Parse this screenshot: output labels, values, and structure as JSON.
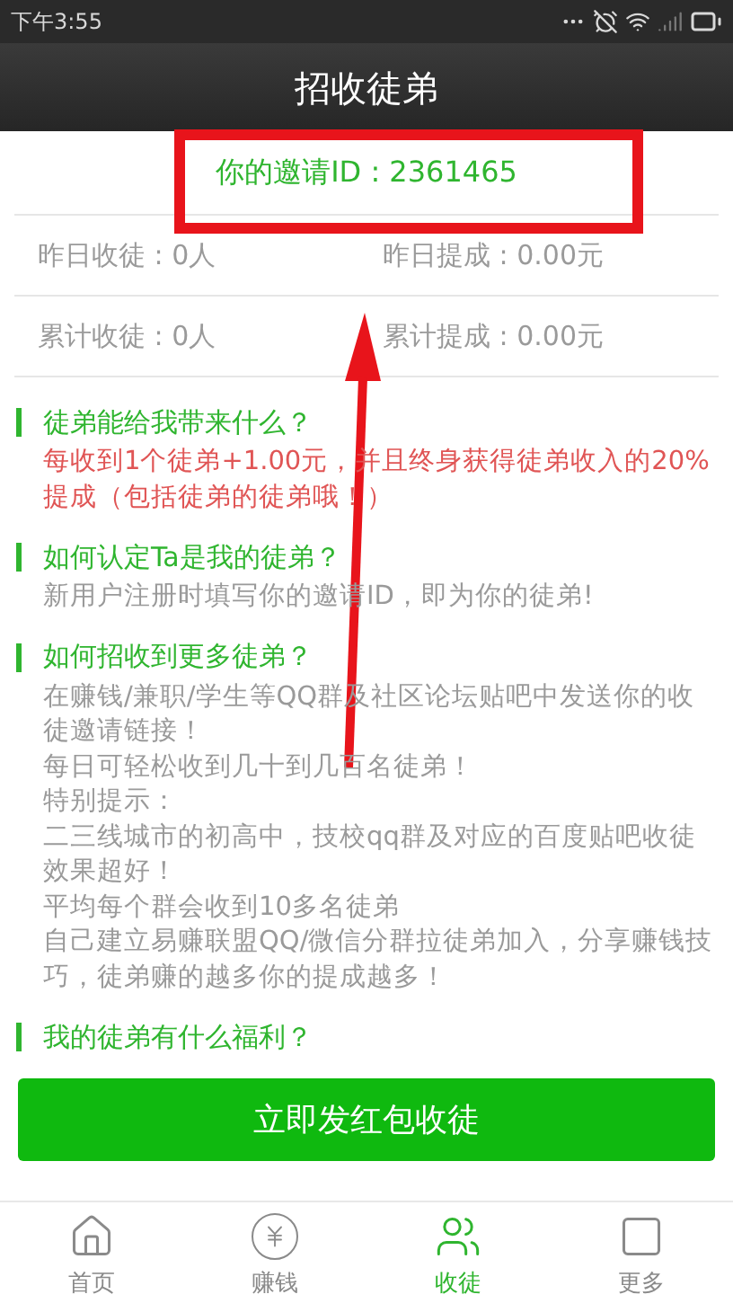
{
  "status_bar": {
    "time": "下午3:55"
  },
  "title": "招收徒弟",
  "invite": {
    "text": "你的邀请ID : 2361465"
  },
  "stats": [
    {
      "left": "昨日收徒 : 0人",
      "right": "昨日提成 : 0.00元"
    },
    {
      "left": "累计收徒 : 0人",
      "right": "累计提成 : 0.00元"
    }
  ],
  "sections": [
    {
      "heading": "徒弟能给我带来什么？",
      "paragraphs": [
        {
          "kind": "highlight",
          "text": "每收到1个徒弟+1.00元，并且终身获得徒弟收入的20%提成（包括徒弟的徒弟哦！）"
        }
      ]
    },
    {
      "heading": "如何认定Ta是我的徒弟？",
      "paragraphs": [
        {
          "kind": "plain",
          "text": "新用户注册时填写你的邀请ID，即为你的徒弟!"
        }
      ]
    },
    {
      "heading": "如何招收到更多徒弟？",
      "paragraphs": [
        {
          "kind": "plain",
          "text": "在赚钱/兼职/学生等QQ群及社区论坛贴吧中发送你的收徒邀请链接！"
        },
        {
          "kind": "plain",
          "text": "每日可轻松收到几十到几百名徒弟！"
        },
        {
          "kind": "plain",
          "text": "特别提示："
        },
        {
          "kind": "plain",
          "text": "二三线城市的初高中，技校qq群及对应的百度贴吧收徒效果超好！"
        },
        {
          "kind": "plain",
          "text": "平均每个群会收到10多名徒弟"
        },
        {
          "kind": "plain",
          "text": "自己建立易赚联盟QQ/微信分群拉徒弟加入，分享赚钱技巧，徒弟赚的越多你的提成越多！"
        }
      ]
    },
    {
      "heading": "我的徒弟有什么福利？"
    }
  ],
  "action_button": "立即发红包收徒",
  "nav": [
    {
      "kind": "home",
      "label": "首页",
      "selected": false
    },
    {
      "kind": "earn",
      "label": "赚钱",
      "selected": false
    },
    {
      "kind": "recruit",
      "label": "收徒",
      "selected": true
    },
    {
      "kind": "more",
      "label": "更多",
      "selected": false
    }
  ]
}
